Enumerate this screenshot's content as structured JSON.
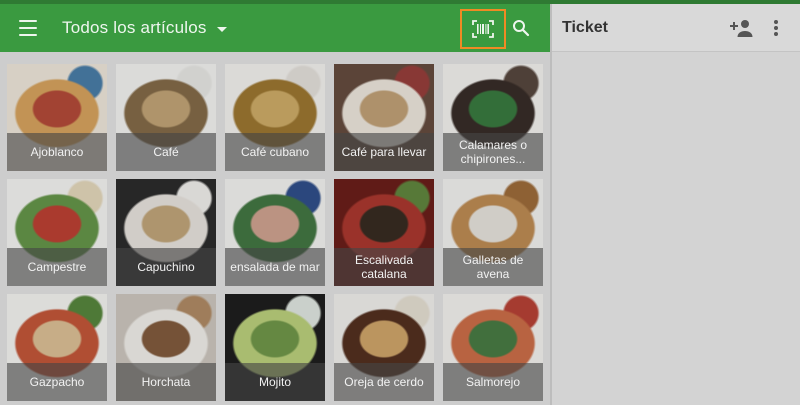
{
  "header": {
    "category_label": "Todos los artículos",
    "icons": [
      "menu-icon",
      "dropdown-caret-icon",
      "barcode-scanner-icon",
      "search-icon"
    ],
    "colors": {
      "appbar": "#3a9a40",
      "highlight": "#f08a24"
    }
  },
  "items": [
    {
      "label": "Ajoblanco",
      "palette": [
        "#f0e7d8",
        "#e3a24b",
        "#c9452f",
        "#3f7fb5"
      ]
    },
    {
      "label": "Café",
      "palette": [
        "#f3f3f0",
        "#8a6a3f",
        "#c9a46a",
        "#e8e8e4"
      ]
    },
    {
      "label": "Café cubano",
      "palette": [
        "#f4f2ee",
        "#a5761f",
        "#d6ac56",
        "#e6e2db"
      ]
    },
    {
      "label": "Café para llevar",
      "palette": [
        "#6a4a3a",
        "#efe7da",
        "#c9a06b",
        "#a83a36"
      ]
    },
    {
      "label": "Calamares o chipirones...",
      "palette": [
        "#f3f2ee",
        "#3a2c26",
        "#2d7f35",
        "#5a463b"
      ]
    },
    {
      "label": "Campestre",
      "palette": [
        "#f5f5f2",
        "#5d9a3a",
        "#d63a2a",
        "#e8d8b4"
      ]
    },
    {
      "label": "Capuchino",
      "palette": [
        "#2b2b2b",
        "#e9e4dd",
        "#c8a56e",
        "#f2f0ec"
      ]
    },
    {
      "label": "ensalada de mar",
      "palette": [
        "#f4f3f0",
        "#3a7a3a",
        "#d9a18a",
        "#28509a"
      ]
    },
    {
      "label": "Escalivada catalana",
      "palette": [
        "#7a1a14",
        "#c23226",
        "#3a2b1f",
        "#5a8a30"
      ]
    },
    {
      "label": "Galletas de avena",
      "palette": [
        "#f2f2f0",
        "#c98a44",
        "#e8e4dc",
        "#a86a2c"
      ]
    },
    {
      "label": "Gazpacho",
      "palette": [
        "#f5f4f0",
        "#d9512c",
        "#e4c08a",
        "#4f8a2e"
      ]
    },
    {
      "label": "Horchata",
      "palette": [
        "#cfc7bd",
        "#f2efe9",
        "#8a5a34",
        "#b98a5a"
      ]
    },
    {
      "label": "Mojito",
      "palette": [
        "#1e1e1e",
        "#b9d46a",
        "#6a9a3a",
        "#dfe8e0"
      ]
    },
    {
      "label": "Oreja de cerdo",
      "palette": [
        "#f1f0ec",
        "#5a2e1a",
        "#d9a45a",
        "#e8e0d0"
      ]
    },
    {
      "label": "Salmorejo",
      "palette": [
        "#f4f2ee",
        "#e06a3a",
        "#3f7f3a",
        "#cf3c2c"
      ]
    }
  ],
  "ticket": {
    "title": "Ticket",
    "icons": [
      "add-customer-icon",
      "more-vert-icon"
    ]
  }
}
